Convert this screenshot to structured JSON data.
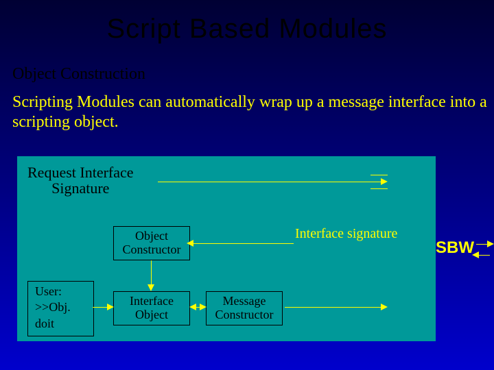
{
  "title": "Script Based Modules",
  "subtitle": "Object Construction",
  "body_text": "Scripting Modules can automatically wrap up a message interface into a scripting object.",
  "request_label": "Request Interface\nSignature",
  "object_constructor": "Object\nConstructor",
  "interface_object": "Interface\nObject",
  "message_constructor": "Message\nConstructor",
  "user_label": "User:",
  "user_cmd": ">>Obj. doit",
  "interface_signature": "Interface signature",
  "sbw": "SBW"
}
